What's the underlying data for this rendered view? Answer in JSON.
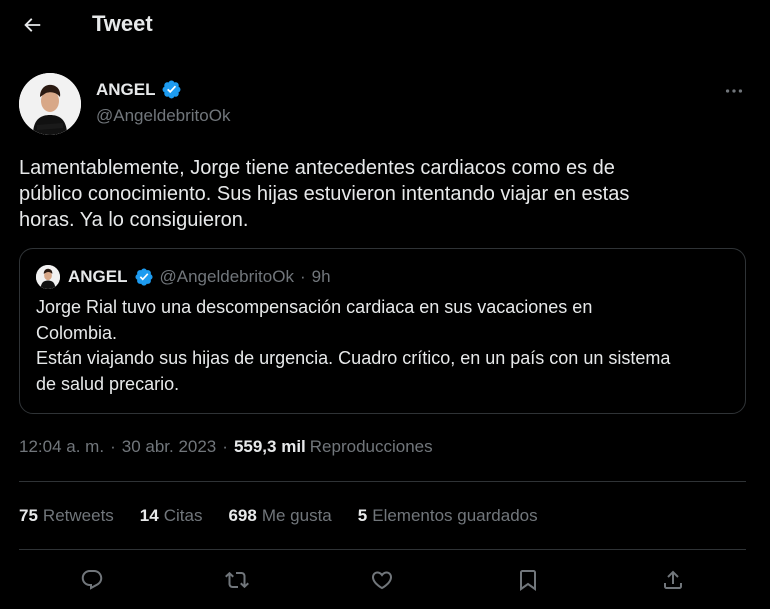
{
  "header": {
    "title": "Tweet"
  },
  "author": {
    "name": "ANGEL",
    "handle": "@AngeldebritoOk",
    "verified": true
  },
  "tweet": {
    "text": "Lamentablemente, Jorge tiene antecedentes cardiacos como es de\npúblico conocimiento. Sus hijas estuvieron intentando viajar en estas\nhoras. Ya lo consiguieron."
  },
  "quote": {
    "name": "ANGEL",
    "handle": "@AngeldebritoOk",
    "separator": "·",
    "time": "9h",
    "text": "Jorge Rial tuvo una descompensación cardiaca en sus vacaciones en\nColombia.\nEstán viajando sus hijas de urgencia. Cuadro crítico, en un país con un sistema\nde salud precario."
  },
  "meta": {
    "time": "12:04 a. m.",
    "separator": "·",
    "date": "30 abr. 2023",
    "views_count": "559,3 mil",
    "views_label": "Reproducciones"
  },
  "stats": {
    "retweets_count": "75",
    "retweets_label": "Retweets",
    "quotes_count": "14",
    "quotes_label": "Citas",
    "likes_count": "698",
    "likes_label": "Me gusta",
    "bookmarks_count": "5",
    "bookmarks_label": "Elementos guardados"
  },
  "colors": {
    "background": "#000000",
    "text_primary": "#e7e9ea",
    "text_secondary": "#71767b",
    "border": "#2f3336",
    "verified_blue": "#1d9bf0"
  },
  "icons": {
    "back": "arrow-left-icon",
    "verified": "verified-badge-icon",
    "more": "more-horizontal-icon",
    "reply": "reply-icon",
    "retweet": "retweet-icon",
    "like": "heart-icon",
    "bookmark": "bookmark-icon",
    "share": "share-icon"
  }
}
